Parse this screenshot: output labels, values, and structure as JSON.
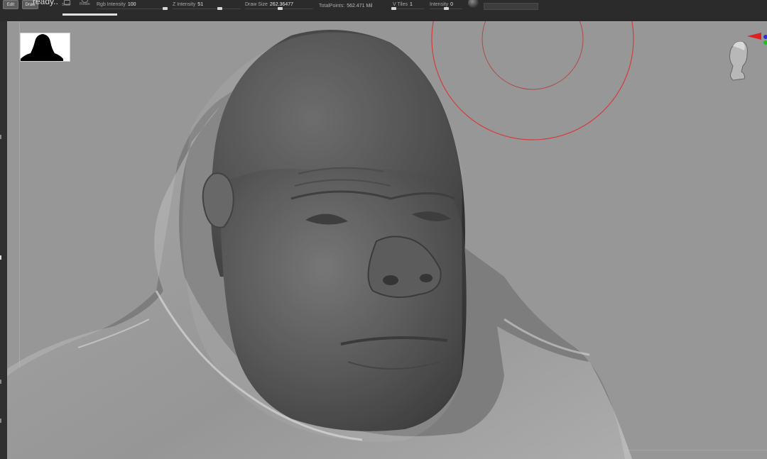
{
  "shelf": {
    "edit_label": "Edit",
    "draw_label": "Draw",
    "ready_text": "ready..",
    "scale_label": "Scale",
    "rotate_label": "Rotate",
    "sliders": {
      "rgb_intensity": {
        "label": "Rgb Intensity",
        "value": "100"
      },
      "z_intensity": {
        "label": "Z Intensity",
        "value": "51"
      },
      "draw_size": {
        "label": "Draw Size",
        "value": "262.36477"
      },
      "v_tiles": {
        "label": "V Tiles",
        "value": "1"
      },
      "intensity": {
        "label": "Intensity",
        "value": "0"
      }
    },
    "total_points": {
      "label": "TotalPoints:",
      "value": "562.471 Mil"
    }
  },
  "colors": {
    "viewport_bg": "#979797",
    "brush_cursor": "#d63c3c",
    "shelf_bg": "#2b2b2b"
  },
  "icons": [
    "scale-icon",
    "rotate-icon",
    "material-sphere-icon",
    "navigation-head-icon",
    "axis-gizmo-icon"
  ]
}
